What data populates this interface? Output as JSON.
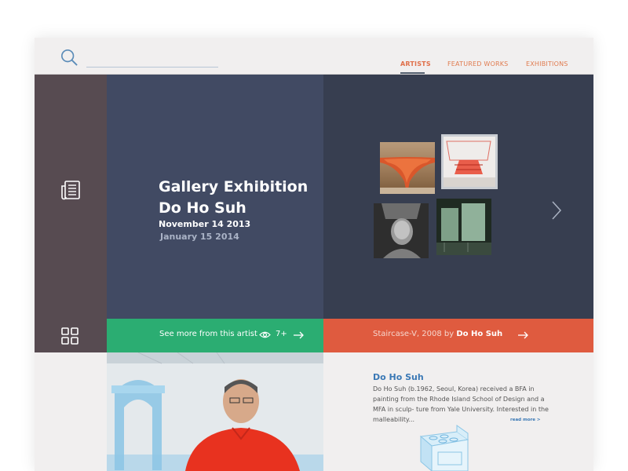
{
  "header": {
    "search_placeholder": "",
    "nav": [
      {
        "label": "ARTISTS",
        "active": true
      },
      {
        "label": "FEATURED WORKS",
        "active": false
      },
      {
        "label": "EXHIBITIONS",
        "active": false
      }
    ]
  },
  "hero": {
    "title_line1": "Gallery Exhibition",
    "title_line2": "Do Ho Suh",
    "date_start": "November 14 2013",
    "date_end": "January 15 2014"
  },
  "bars": {
    "green_label": "See more from this artist",
    "views_count": "7+",
    "red_label_prefix": "Staircase-V, 2008 by ",
    "red_label_artist": "Do Ho Suh"
  },
  "artist_info": {
    "name": "Do Ho Suh",
    "bio": "Do Ho Suh (b.1962, Seoul, Korea) received a BFA in painting from the Rhode Island School of Design and a MFA in sculp- ture from Yale University. Interested in the malleability...",
    "read_more": "read more >"
  },
  "colors": {
    "sidebar": "#574b51",
    "hero": "#414a63",
    "gallery": "#373e50",
    "green": "#2bad72",
    "red": "#df5b3f",
    "accent_orange": "#e0704a",
    "link_blue": "#3a78b5"
  },
  "icons": {
    "search": "search-icon",
    "article": "newspaper-icon",
    "grid": "grid-icon",
    "eye": "eye-icon",
    "arrow": "arrow-right-icon",
    "chevron": "chevron-right-icon"
  }
}
